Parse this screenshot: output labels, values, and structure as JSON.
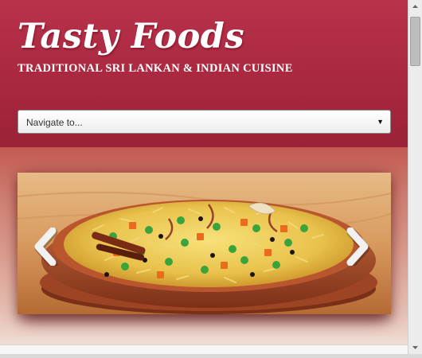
{
  "header": {
    "site_title": "Tasty Foods",
    "tagline": "TRADITIONAL SRI LANKAN & INDIAN CUISINE"
  },
  "navigation": {
    "selected": "Navigate to..."
  },
  "slider": {
    "slide_image": "biryani-dish",
    "prev_icon": "chevron-left-icon",
    "next_icon": "chevron-right-icon"
  },
  "colors": {
    "header": "#b8324a",
    "header_dark": "#9a2237",
    "text": "#ffffff"
  }
}
